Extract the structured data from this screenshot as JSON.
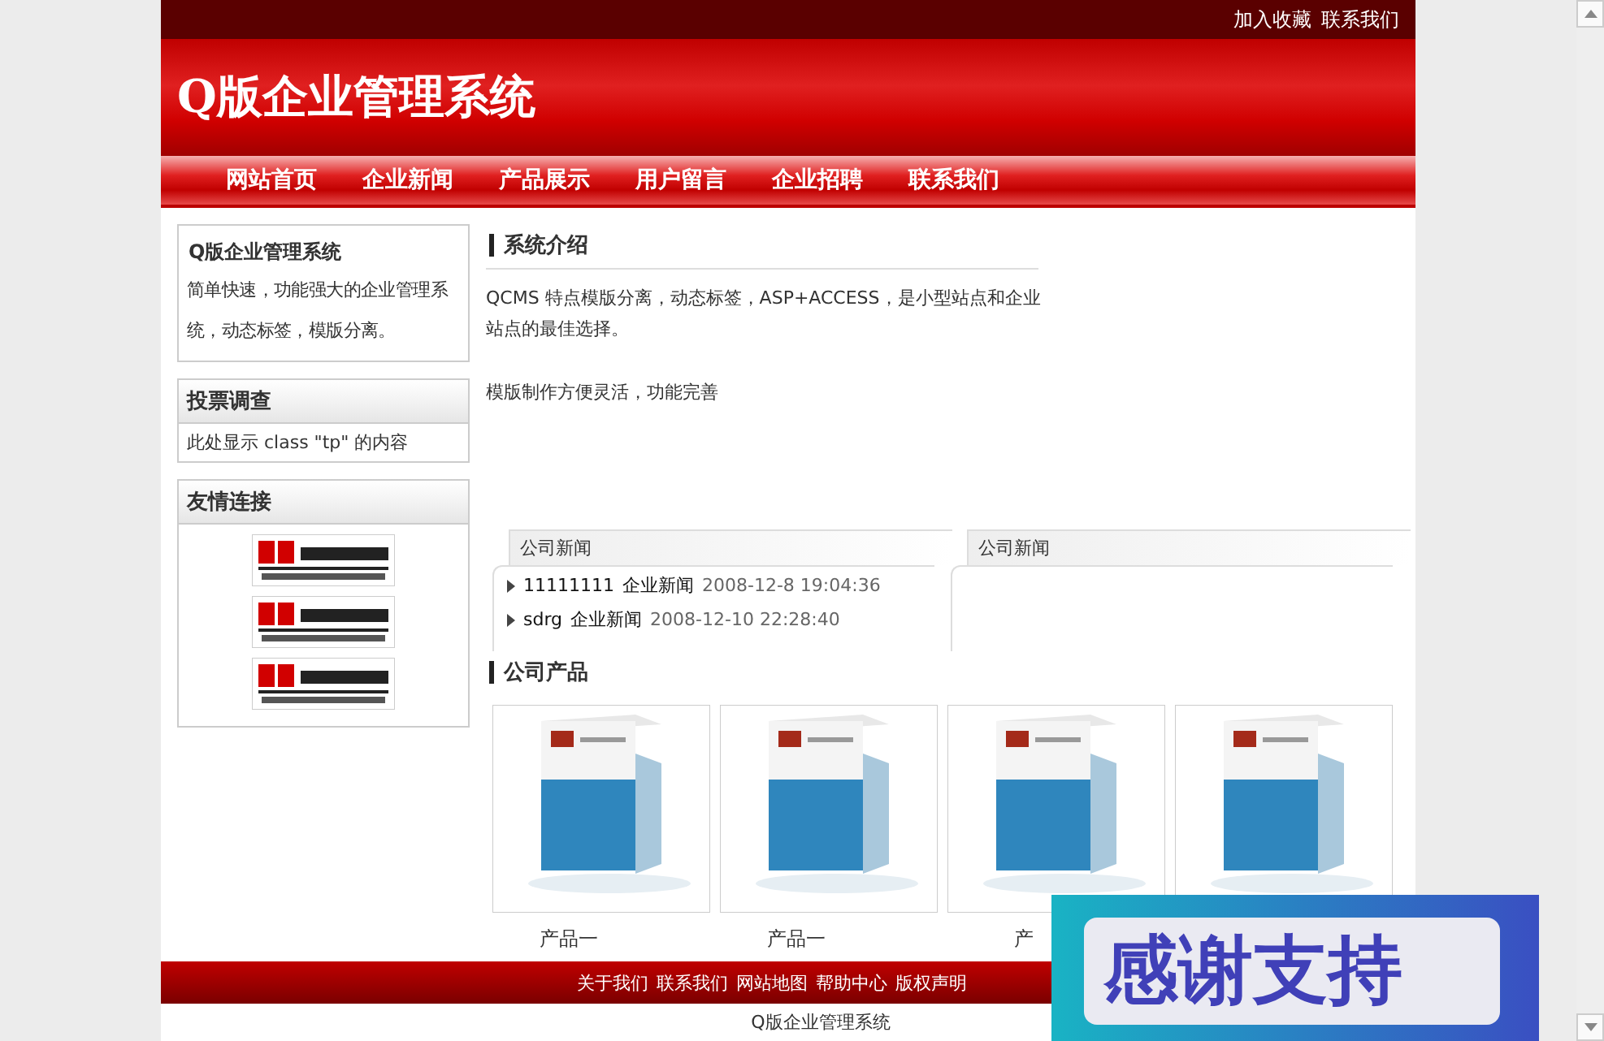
{
  "top_links": [
    "加入收藏",
    "联系我们"
  ],
  "site_title": "Q版企业管理系统",
  "nav": [
    {
      "label": "网站首页"
    },
    {
      "label": "企业新闻"
    },
    {
      "label": "产品展示"
    },
    {
      "label": "用户留言"
    },
    {
      "label": "企业招聘"
    },
    {
      "label": "联系我们"
    }
  ],
  "sidebar": {
    "intro": {
      "title": "Q版企业管理系统",
      "text": "简单快速，功能强大的企业管理系统，动态标签，模版分离。"
    },
    "poll": {
      "title": "投票调查",
      "text": "此处显示 class \"tp\" 的内容"
    },
    "links": {
      "title": "友情连接",
      "banners": [
        {
          "kind": "picture"
        },
        {
          "kind": "picture"
        },
        {
          "kind": "picture"
        }
      ]
    }
  },
  "intro": {
    "title": "系统介绍",
    "paragraphs": [
      "QCMS 特点模版分离，动态标签，ASP+ACCESS，是小型站点和企业站点的最佳选择。",
      "模版制作方便灵活，功能完善"
    ]
  },
  "news": [
    {
      "tab": "公司新闻",
      "items": [
        {
          "title": "11111111",
          "category": "企业新闻",
          "date": "2008-12-8 19:04:36"
        },
        {
          "title": "sdrg",
          "category": "企业新闻",
          "date": "2008-12-10 22:28:40"
        }
      ]
    },
    {
      "tab": "公司新闻"
    }
  ],
  "products": {
    "title": "公司产品",
    "items": [
      {
        "kind": "picture",
        "label": "产品一"
      },
      {
        "kind": "picture",
        "label": "产品一"
      },
      {
        "kind": "picture",
        "label": "产"
      },
      {
        "kind": "picture"
      }
    ]
  },
  "footer": {
    "links": [
      "关于我们",
      "联系我们",
      "网站地图",
      "帮助中心",
      "版权声明"
    ],
    "copyright": "Q版企业管理系统"
  },
  "overlay": {
    "text": "感谢支持"
  }
}
